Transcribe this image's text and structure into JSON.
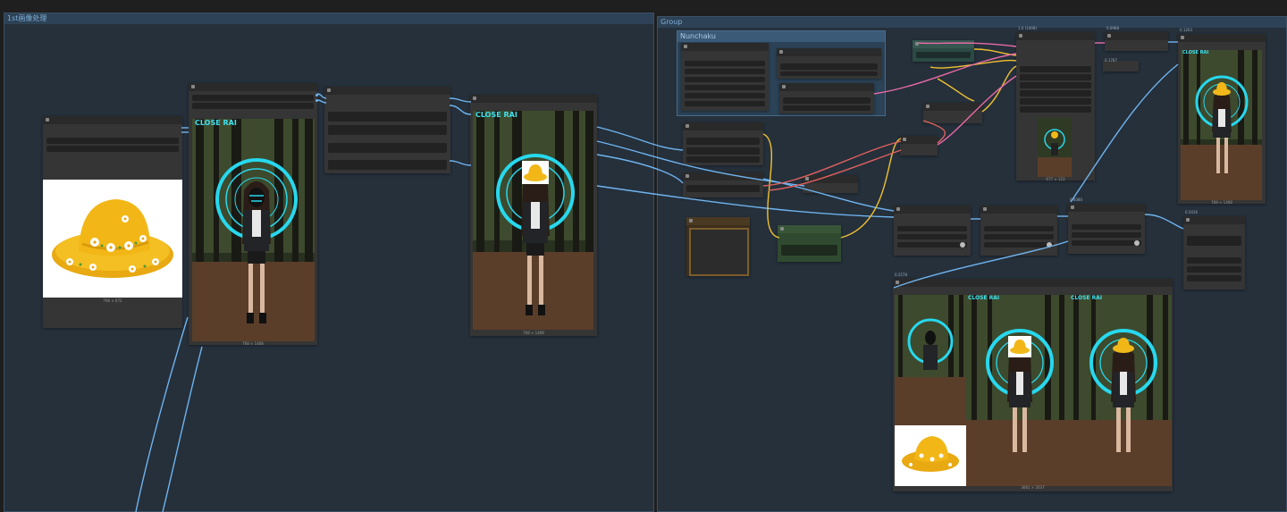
{
  "groups": [
    {
      "title": "1st画像处理"
    },
    {
      "title": "Group"
    },
    {
      "title": "Nunchaku"
    }
  ],
  "image_captions": {
    "hat_input": "796 × 672",
    "person_preview": "768 × 1408",
    "inpaint_preview": "768 × 1408",
    "pipeline_preview": "677 × 123",
    "result_right": "768 × 1408",
    "compare_grid": "3061 × 2037"
  },
  "overlay_text": "CLOSE RAI",
  "mini_labels": {
    "a": "1.0 (1408)",
    "b": "0.6988",
    "c": "0.1203",
    "d": "0.5416",
    "e": "0.1787",
    "f": "0.6080",
    "g": "0.2578"
  },
  "colors": {
    "background": "#1e1e1e",
    "group_bg": "#25303b",
    "group_title_bg": "#2d4256",
    "wire_blue": "#6fb4ef",
    "wire_yellow": "#f0c030",
    "wire_pink": "#e86aa6",
    "wire_red": "#e0605e",
    "hat_yellow": "#f0b81a",
    "neon": "#27d8ee"
  }
}
